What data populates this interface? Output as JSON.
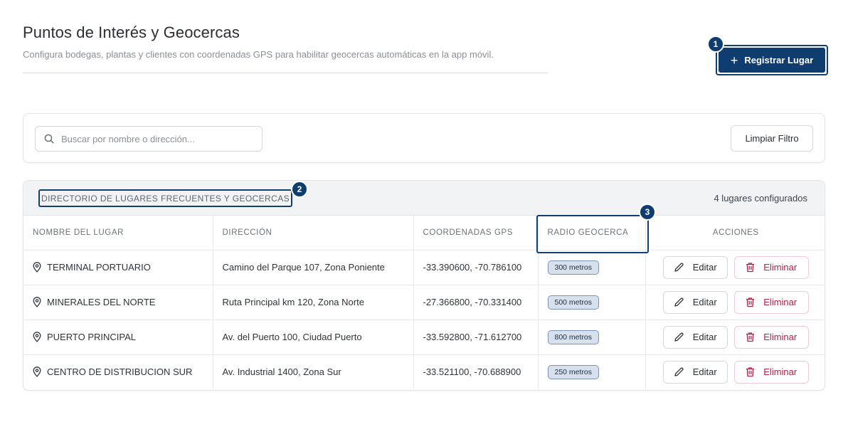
{
  "header": {
    "title": "Puntos de Interés y Geocercas",
    "subtitle": "Configura bodegas, plantas y clientes con coordenadas GPS para habilitar geocercas automáticas en la app móvil.",
    "register_label": "Registrar Lugar"
  },
  "badges": [
    "1",
    "2",
    "3"
  ],
  "filter": {
    "search_placeholder": "Buscar por nombre o dirección...",
    "clear_label": "Limpiar Filtro"
  },
  "directory": {
    "title": "DIRECTORIO DE LUGARES FRECUENTES Y GEOCERCAS",
    "count": "4 lugares configurados"
  },
  "table": {
    "columns": [
      "NOMBRE DEL LUGAR",
      "DIRECCIÓN",
      "COORDENADAS GPS",
      "RADIO GEOCERCA",
      "ACCIONES"
    ],
    "rows": [
      {
        "name": "TERMINAL PORTUARIO",
        "address": "Camino del Parque 107, Zona Poniente",
        "coords": "-33.390600, -70.786100",
        "radius": "300 metros"
      },
      {
        "name": "MINERALES DEL NORTE",
        "address": "Ruta Principal km 120, Zona Norte",
        "coords": "-27.366800, -70.331400",
        "radius": "500 metros"
      },
      {
        "name": "PUERTO PRINCIPAL",
        "address": "Av. del Puerto 100, Ciudad Puerto",
        "coords": "-33.592800, -71.612700",
        "radius": "800 metros"
      },
      {
        "name": "CENTRO DE DISTRIBUCION SUR",
        "address": "Av. Industrial 1400, Zona Sur",
        "coords": "-33.521100, -70.688900",
        "radius": "250 metros"
      }
    ],
    "edit_label": "Editar",
    "delete_label": "Eliminar"
  },
  "colors": {
    "primary": "#0f3d70",
    "danger": "#b0224a",
    "pill_bg": "#d7e1ee"
  }
}
